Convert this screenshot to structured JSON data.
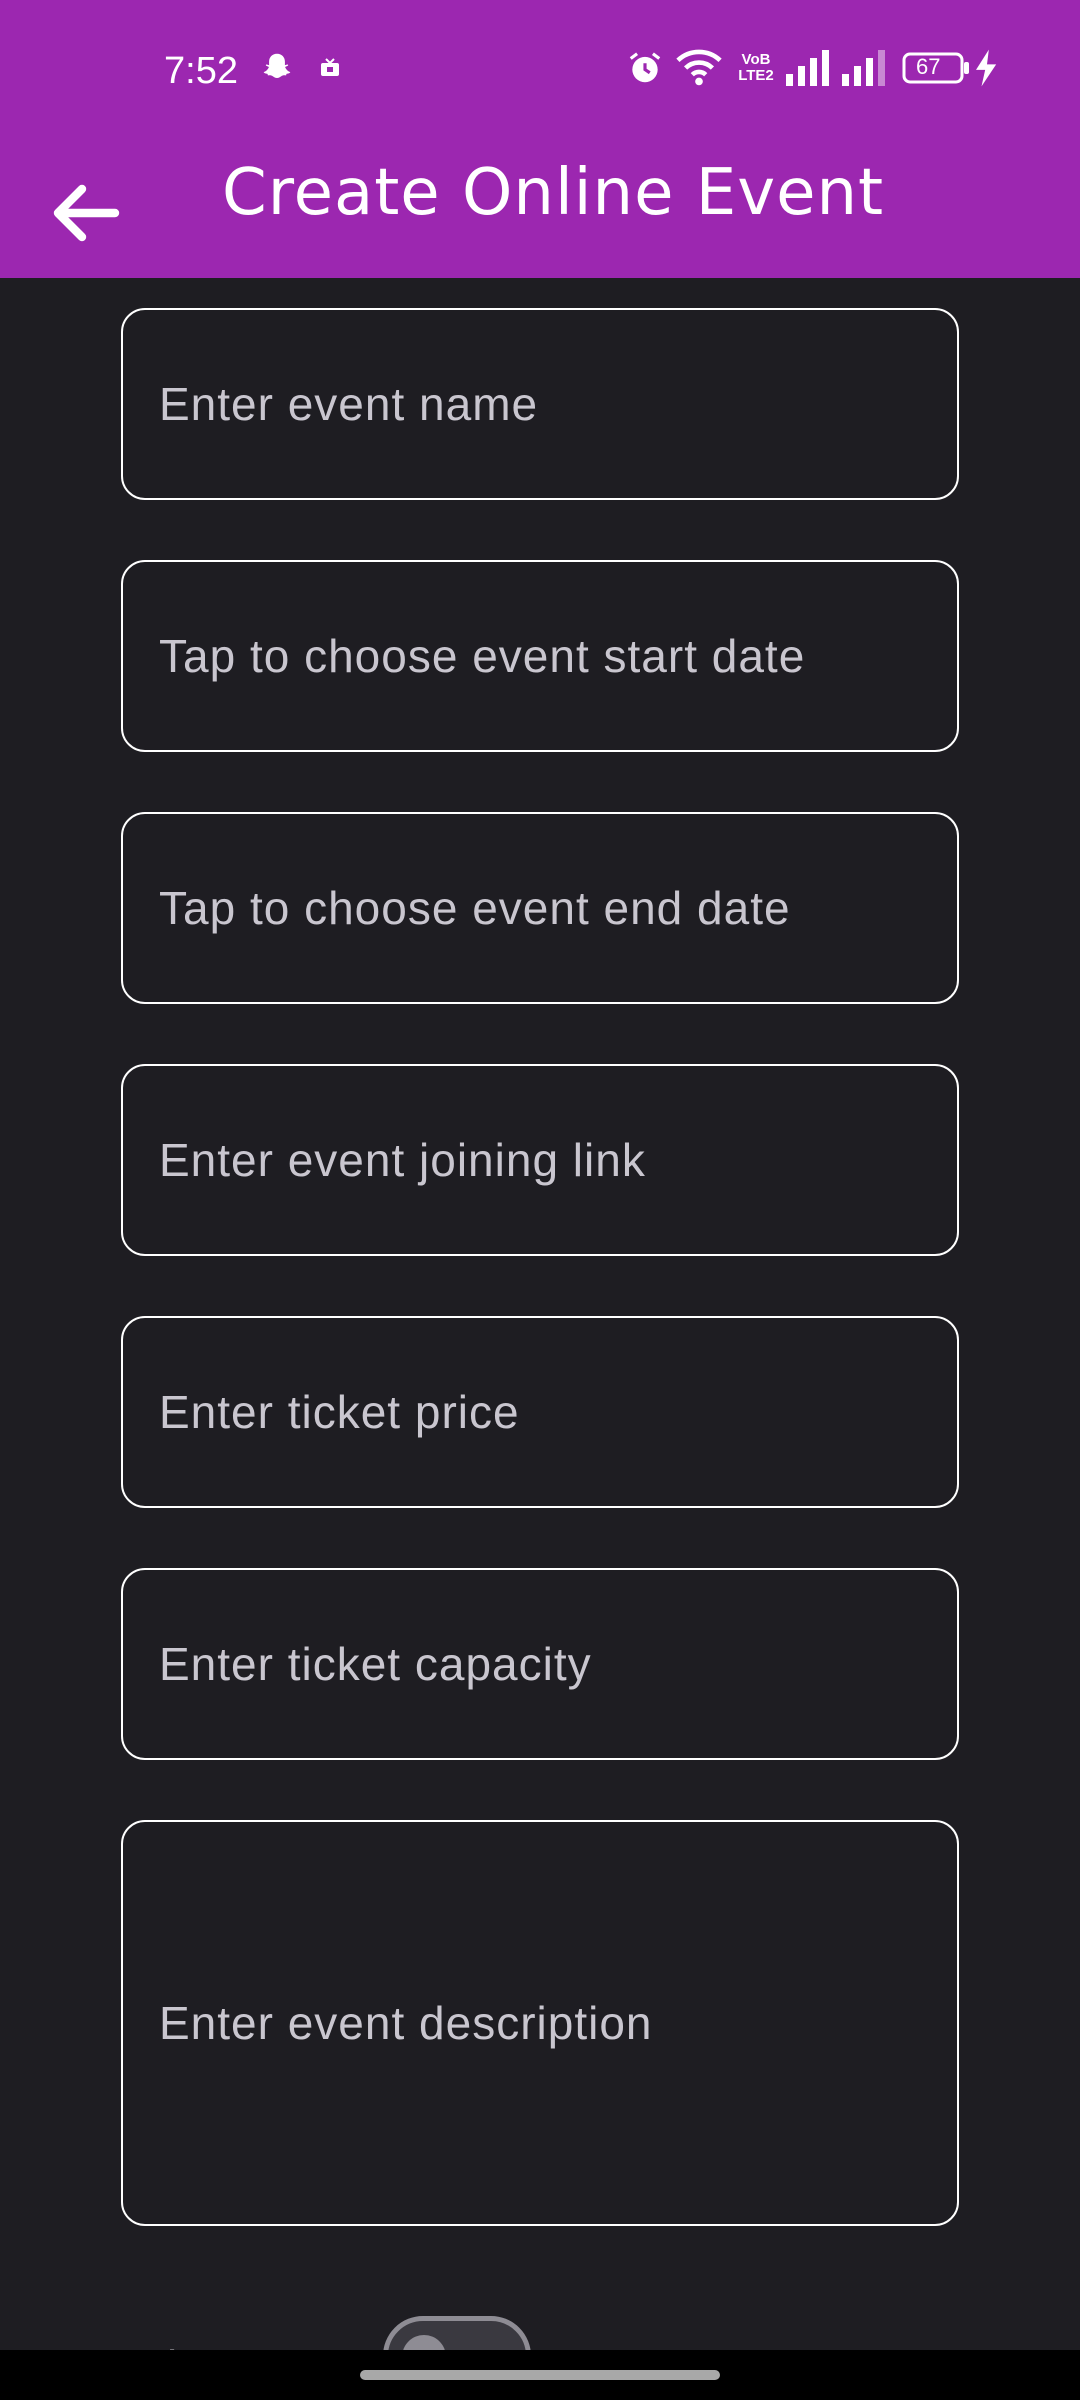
{
  "status_bar": {
    "time": "7:52",
    "battery": "67",
    "icons": [
      "snapchat-icon",
      "notification-icon",
      "alarm-icon",
      "wifi-icon",
      "volte-icon",
      "signal-icon",
      "signal-icon",
      "battery-icon",
      "charging-icon"
    ],
    "volte_text": "VoB LTE2"
  },
  "app_bar": {
    "title": "Create Online Event",
    "back_icon": "arrow-back-icon",
    "color": "#9c27b0"
  },
  "form": {
    "event_name_placeholder": "Enter event name",
    "start_date_placeholder": "Tap to choose event start date",
    "end_date_placeholder": "Tap to choose event end date",
    "joining_link_placeholder": "Enter event joining link",
    "ticket_price_placeholder": "Enter ticket price",
    "ticket_capacity_placeholder": "Enter ticket capacity",
    "description_placeholder": "Enter event description",
    "private_event_label": "Private Event",
    "private_event_on": false
  }
}
